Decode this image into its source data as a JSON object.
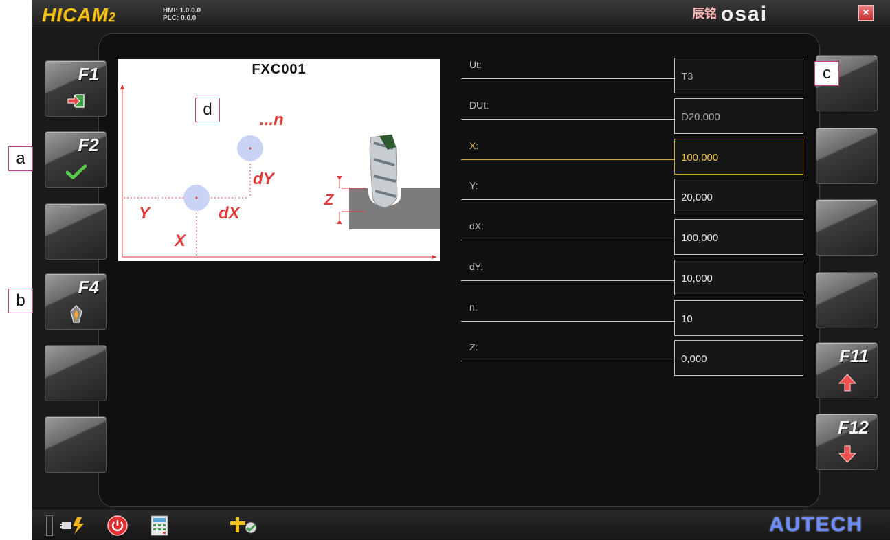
{
  "header": {
    "brand": "HICAM",
    "brand_suffix": "2",
    "hmi_version": "HMI: 1.0.0.0",
    "plc_version": "PLC: 0.0.0",
    "vendor_logo": "osai",
    "vendor_chinese": "辰铭",
    "close_label": "×"
  },
  "callouts": {
    "a": "a",
    "b": "b",
    "c": "c",
    "d": "d"
  },
  "left_keys": [
    {
      "label": "F1",
      "icon": "exit-icon"
    },
    {
      "label": "F2",
      "icon": "checkmark-icon"
    },
    {
      "label": "",
      "icon": ""
    },
    {
      "label": "F4",
      "icon": "tool-icon"
    },
    {
      "label": "",
      "icon": ""
    },
    {
      "label": "",
      "icon": ""
    }
  ],
  "right_keys": [
    {
      "label": "",
      "icon": ""
    },
    {
      "label": "",
      "icon": ""
    },
    {
      "label": "",
      "icon": ""
    },
    {
      "label": "",
      "icon": ""
    },
    {
      "label": "F11",
      "icon": "arrow-up-icon"
    },
    {
      "label": "F12",
      "icon": "arrow-down-icon"
    }
  ],
  "diagram": {
    "title": "FXC001",
    "labels": {
      "n": "...n",
      "dY": "dY",
      "dX": "dX",
      "Y": "Y",
      "X": "X",
      "Z": "Z"
    }
  },
  "params": [
    {
      "label": "Ut:",
      "value": "T3",
      "readonly": true
    },
    {
      "label": "DUt:",
      "value": "D20.000",
      "readonly": true
    },
    {
      "label": "X:",
      "value": "100,000",
      "active": true
    },
    {
      "label": "Y:",
      "value": "20,000"
    },
    {
      "label": "dX:",
      "value": "100,000"
    },
    {
      "label": "dY:",
      "value": "10,000"
    },
    {
      "label": "n:",
      "value": "10"
    },
    {
      "label": "Z:",
      "value": "0,000"
    }
  ],
  "footer": {
    "icons": [
      "power-plug-icon",
      "power-button-icon",
      "calculator-icon",
      "axes-icon"
    ],
    "logo": "AUTECH"
  },
  "colors": {
    "accent": "#f2c21a",
    "active_field": "#d4aa2e",
    "diagram_red": "#e23b3b",
    "hole_fill": "#c9d4f5"
  }
}
